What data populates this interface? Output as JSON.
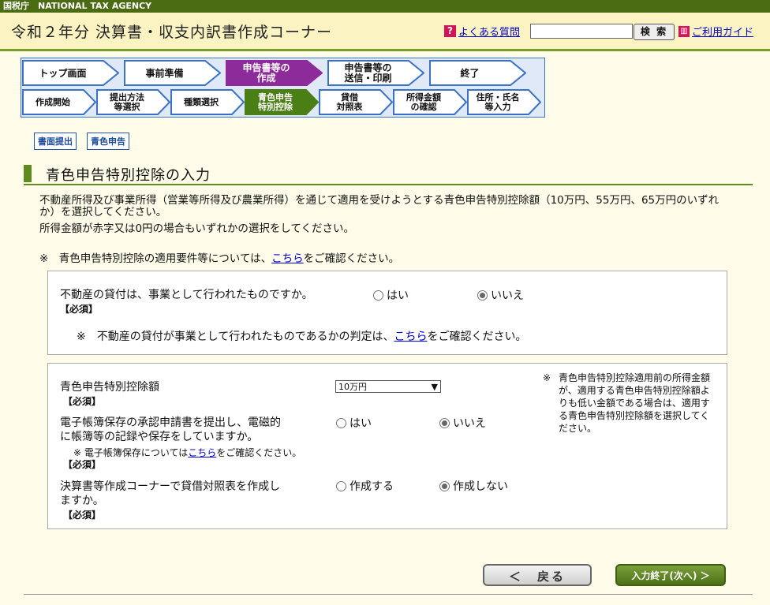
{
  "agency_bar": "国税庁　NATIONAL TAX AGENCY",
  "header": {
    "title": "令和２年分 決算書・収支内訳書作成コーナー",
    "faq_icon": "?",
    "faq_label": "よくある質問",
    "search_placeholder": "",
    "search_button": "検 索",
    "guide_label": "ご利用ガイド"
  },
  "main_steps": [
    {
      "label": "トップ画面",
      "active": false
    },
    {
      "label": "事前準備",
      "active": false
    },
    {
      "label": "申告書等の\n作成",
      "active": true
    },
    {
      "label": "申告書等の\n送信・印刷",
      "active": false
    },
    {
      "label": "終了",
      "active": false
    }
  ],
  "sub_steps": [
    {
      "label": "作成開始",
      "active": false
    },
    {
      "label": "提出方法\n等選択",
      "active": false
    },
    {
      "label": "種類選択",
      "active": false
    },
    {
      "label": "青色申告\n特別控除",
      "active": true
    },
    {
      "label": "貸借\n対照表",
      "active": false
    },
    {
      "label": "所得金額\nの確認",
      "active": false
    },
    {
      "label": "住所・氏名\n等入力",
      "active": false
    }
  ],
  "tags": [
    "書面提出",
    "青色申告"
  ],
  "section_title": "青色申告特別控除の入力",
  "intro": {
    "line1": "不動産所得及び事業所得（営業等所得及び農業所得）を通じて適用を受けようとする青色申告特別控除額（10万円、55万円、65万円のいずれか）を選択してください。",
    "line2": "所得金額が赤字又は0円の場合もいずれかの選択をしてください。"
  },
  "note1": {
    "prefix": "※　青色申告特別控除の適用要件等については、",
    "link": "こちら",
    "suffix": "をご確認ください。"
  },
  "q1": {
    "question": "不動産の貸付は、事業として行われたものですか。",
    "required": "【必須】",
    "options": [
      "はい",
      "いいえ"
    ],
    "selected": 1,
    "note_prefix": "※　不動産の貸付が事業として行われたものであるかの判定は、",
    "note_link": "こちら",
    "note_suffix": "をご確認ください。"
  },
  "q2": {
    "label": "青色申告特別控除額",
    "required": "【必須】",
    "selected_value": "10万円"
  },
  "q3": {
    "question_line1": "電子帳簿保存の承認申請書を提出し、電磁的",
    "question_line2": "に帳簿等の記録や保存をしていますか。",
    "note_prefix": "※ 電子帳簿保存については",
    "note_link": "こちら",
    "note_suffix": "をご確認ください。",
    "required": "【必須】",
    "options": [
      "はい",
      "いいえ"
    ],
    "selected": 1
  },
  "q4": {
    "question_line1": "決算書等作成コーナーで貸借対照表を作成し",
    "question_line2": "ますか。",
    "required": "【必須】",
    "options": [
      "作成する",
      "作成しない"
    ],
    "selected": 1
  },
  "side_note": {
    "mark": "※",
    "text": "青色申告特別控除適用前の所得金額が、適用する青色申告特別控除額よりも低い金額である場合は、適用する青色申告特別控除額を選択してください。"
  },
  "buttons": {
    "back": "＜　戻る",
    "next": "入力終了(次へ) ＞"
  },
  "colors": {
    "accent": "#5f8a1e",
    "active_step": "#8e2b9a",
    "step_border": "#3a72c8",
    "active_substep": "#4a7f15"
  }
}
